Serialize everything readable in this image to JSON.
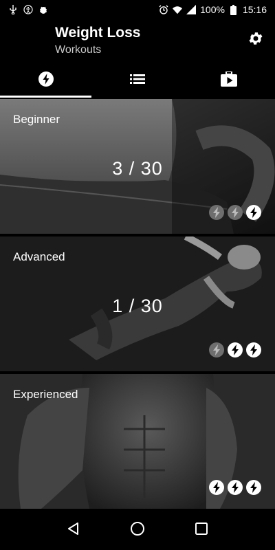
{
  "status_bar": {
    "battery": "100%",
    "time": "15:16",
    "icons": [
      "usb-icon",
      "accessibility-icon",
      "android-debug-icon",
      "alarm-icon",
      "wifi-icon",
      "signal-icon",
      "battery-icon"
    ]
  },
  "app_bar": {
    "title": "Weight Loss",
    "subtitle": "Workouts",
    "settings_icon": "gear-icon"
  },
  "tabs": [
    {
      "icon": "bolt-icon",
      "active": true
    },
    {
      "icon": "list-icon",
      "active": false
    },
    {
      "icon": "briefcase-play-icon",
      "active": false
    }
  ],
  "workouts": [
    {
      "label": "Beginner",
      "progress": "3 / 30",
      "level": 1,
      "max_level": 3
    },
    {
      "label": "Advanced",
      "progress": "1 / 30",
      "level": 2,
      "max_level": 3
    },
    {
      "label": "Experienced",
      "progress": "",
      "level": 3,
      "max_level": 3
    }
  ],
  "nav_bar": {
    "back_icon": "back-triangle-icon",
    "home_icon": "home-circle-icon",
    "recents_icon": "recents-square-icon"
  },
  "colors": {
    "background": "#000000",
    "text": "#ffffff",
    "bolt_on": "#ffffff",
    "bolt_off": "#6e6e6e"
  }
}
